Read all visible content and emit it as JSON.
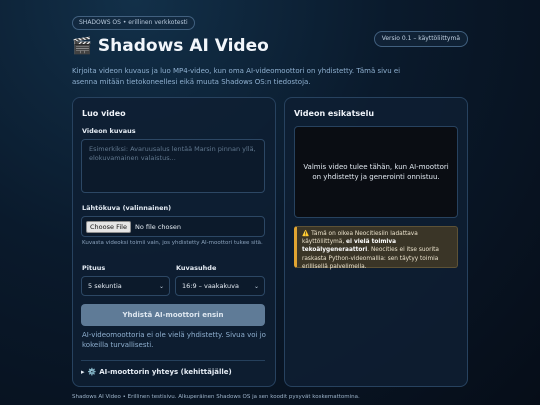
{
  "header": {
    "os_pill": "SHADOWS OS • erillinen verkkotesti",
    "version_pill": "Versio 0.1 – käyttöliittymä",
    "title_icon": "clapperboard-icon",
    "title": "Shadows AI Video",
    "intro": "Kirjoita videon kuvaus ja luo MP4-video, kun oma AI-videomoottori on yhdistetty. Tämä sivu ei asenna mitään tietokoneellesi eikä muuta Shadows OS:n tiedostoja."
  },
  "create": {
    "heading": "Luo video",
    "description_label": "Videon kuvaus",
    "description_placeholder": "Esimerkiksi: Avaruusalus lentää Marsin pinnan yllä, elokuvamainen valaistus...",
    "start_image_label": "Lähtökuva (valinnainen)",
    "choose_file_label": "Choose File",
    "no_file_text": "No file chosen",
    "start_image_hint": "Kuvasta videoksi toimii vain, jos yhdistetty AI-moottori tukee sitä.",
    "duration_label": "Pituus",
    "duration_value": "5 sekuntia",
    "aspect_label": "Kuvasuhde",
    "aspect_value": "16:9 – vaakakuva",
    "connect_button": "Yhdistä AI-moottori ensin",
    "status_text": "AI-videomoottoria ei ole vielä yhdistetty. Sivua voi jo kokeilla turvallisesti.",
    "advanced_icon": "gear-icon",
    "advanced_label": "AI-moottorin yhteys (kehittäjälle)"
  },
  "preview": {
    "heading": "Videon esikatselu",
    "placeholder": "Valmis video tulee tähän, kun AI-moottori on yhdistetty ja generointi onnistuu.",
    "notice_icon": "warning-icon",
    "notice_part1": "Tämä on oikea Neocitiesiin ladattava käyttöliittymä, ",
    "notice_bold": "ei vielä toimiva tekoälygeneraattori",
    "notice_part2": ". Neocities ei itse suorita raskasta Python-videomallia: sen täytyy toimia erillisellä palvelimella."
  },
  "footer": {
    "text": "Shadows AI Video • Erillinen testisivu. Alkuperäinen Shadows OS ja sen koodit pysyvät koskemattomina."
  },
  "colors": {
    "warning_accent": "#e0a432",
    "disabled_button": "#5f7b97",
    "accent_text": "#8fb0d0"
  }
}
